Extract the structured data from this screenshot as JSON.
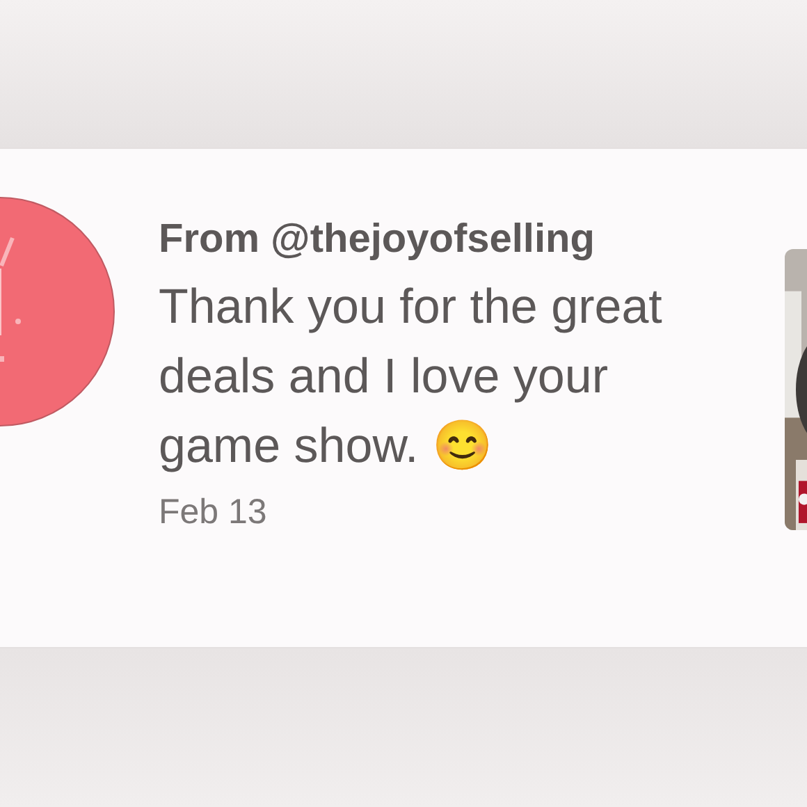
{
  "notification": {
    "from": "From @thejoyofselling",
    "message": "Thank you for the great deals and I love your game show. 😊",
    "date": "Feb 13"
  }
}
